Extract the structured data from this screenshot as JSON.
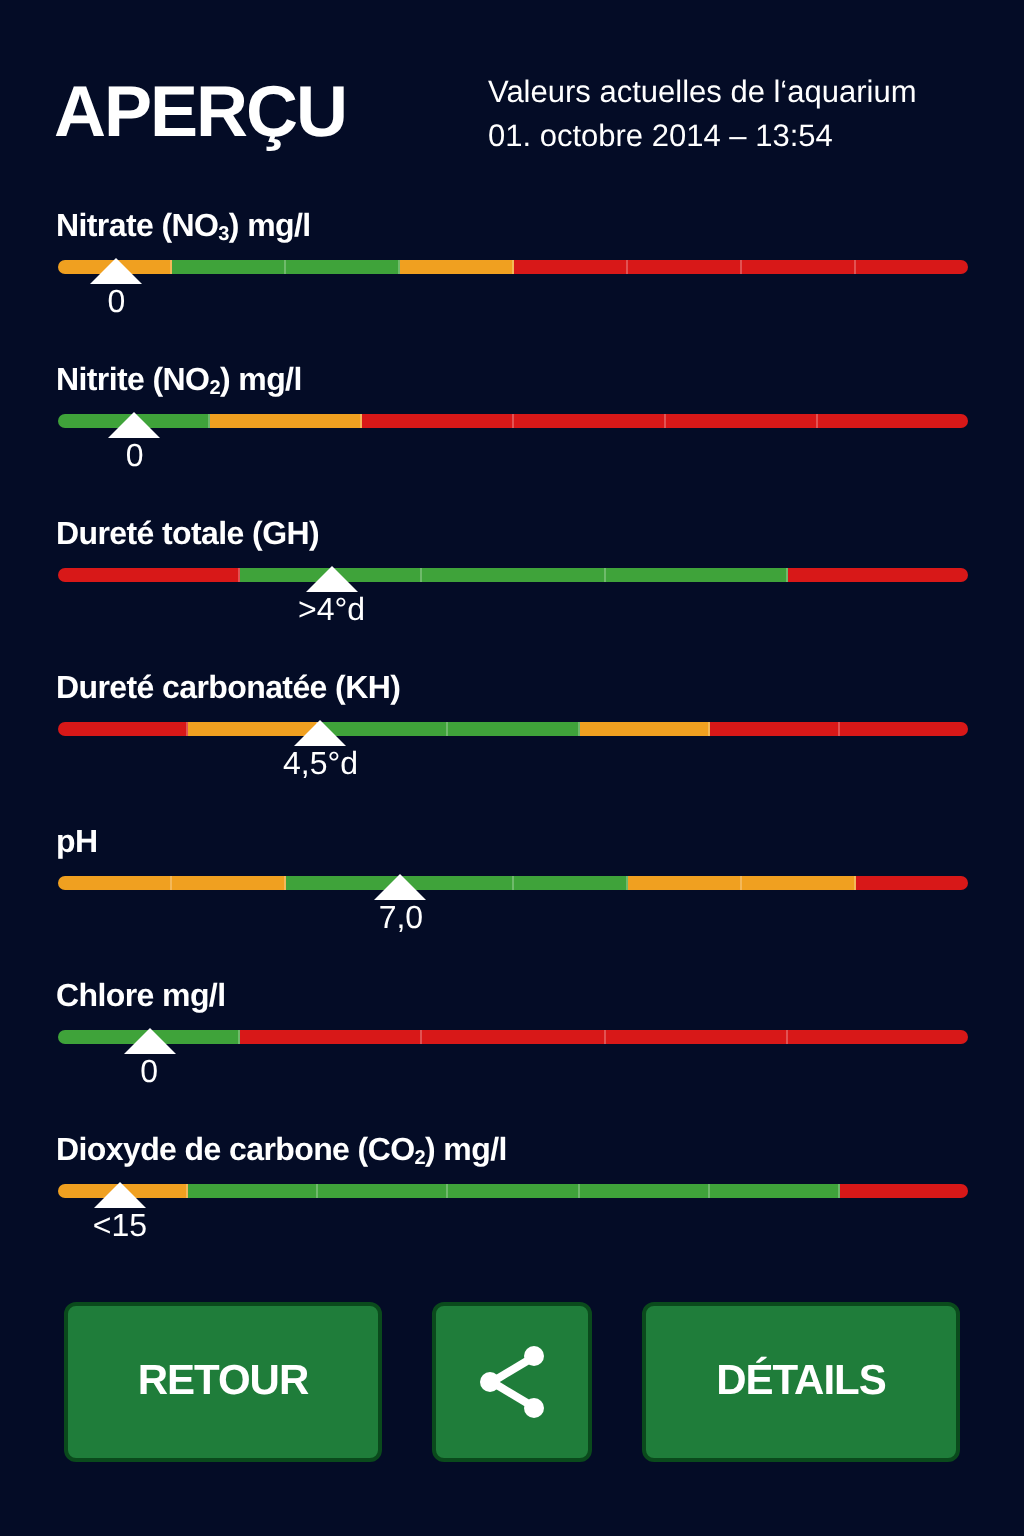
{
  "header": {
    "title": "APERÇU",
    "subtitle": "Valeurs actuelles de l‘aquarium",
    "datetime": "01. octobre 2014 – 13:54"
  },
  "parameters": [
    {
      "name": "Nitrate (NO$_{3}$) mg/l",
      "level": 0.064,
      "reading": "0",
      "segments": [
        {
          "color": "#f0a020"
        },
        {
          "color": "#3fa33a"
        },
        {
          "color": "#3fa33a"
        },
        {
          "color": "#f0a020"
        },
        {
          "color": "#d81818"
        },
        {
          "color": "#d81818"
        },
        {
          "color": "#d81818"
        },
        {
          "color": "#d81818"
        }
      ]
    },
    {
      "name": "Nitrite (NO$_{2}$) mg/l",
      "level": 0.084,
      "reading": "0",
      "segments": [
        {
          "color": "#3fa33a"
        },
        {
          "color": "#f0a020"
        },
        {
          "color": "#d81818"
        },
        {
          "color": "#d81818"
        },
        {
          "color": "#d81818"
        },
        {
          "color": "#d81818"
        }
      ]
    },
    {
      "name": "Dureté totale (GH)",
      "level": 0.3,
      "reading": ">4°d",
      "segments": [
        {
          "color": "#d81818"
        },
        {
          "color": "#3fa33a"
        },
        {
          "color": "#3fa33a"
        },
        {
          "color": "#3fa33a"
        },
        {
          "color": "#d81818"
        }
      ]
    },
    {
      "name": "Dureté carbonatée (KH)",
      "level": 0.288,
      "reading": "4,5°d",
      "segments": [
        {
          "color": "#d81818"
        },
        {
          "color": "#f0a020"
        },
        {
          "color": "#3fa33a"
        },
        {
          "color": "#3fa33a"
        },
        {
          "color": "#f0a020"
        },
        {
          "color": "#d81818"
        },
        {
          "color": "#d81818"
        }
      ]
    },
    {
      "name": "pH",
      "level": 0.376,
      "reading": "7,0",
      "segments": [
        {
          "color": "#f0a020"
        },
        {
          "color": "#f0a020"
        },
        {
          "color": "#3fa33a"
        },
        {
          "color": "#3fa33a"
        },
        {
          "color": "#3fa33a"
        },
        {
          "color": "#f0a020"
        },
        {
          "color": "#f0a020"
        },
        {
          "color": "#d81818"
        }
      ]
    },
    {
      "name": "Chlore mg/l",
      "level": 0.1,
      "reading": "0",
      "segments": [
        {
          "color": "#3fa33a"
        },
        {
          "color": "#d81818"
        },
        {
          "color": "#d81818"
        },
        {
          "color": "#d81818"
        },
        {
          "color": "#d81818"
        }
      ]
    },
    {
      "name": "Dioxyde de carbone (CO$_{2}$) mg/l",
      "level": 0.068,
      "reading": "<15",
      "segments": [
        {
          "color": "#f0a020"
        },
        {
          "color": "#3fa33a"
        },
        {
          "color": "#3fa33a"
        },
        {
          "color": "#3fa33a"
        },
        {
          "color": "#3fa33a"
        },
        {
          "color": "#3fa33a"
        },
        {
          "color": "#d81818"
        }
      ]
    }
  ],
  "buttons": [
    {
      "kind": "text",
      "label": "RETOUR"
    },
    {
      "kind": "share"
    },
    {
      "kind": "text",
      "label": "DÉTAILS"
    }
  ]
}
